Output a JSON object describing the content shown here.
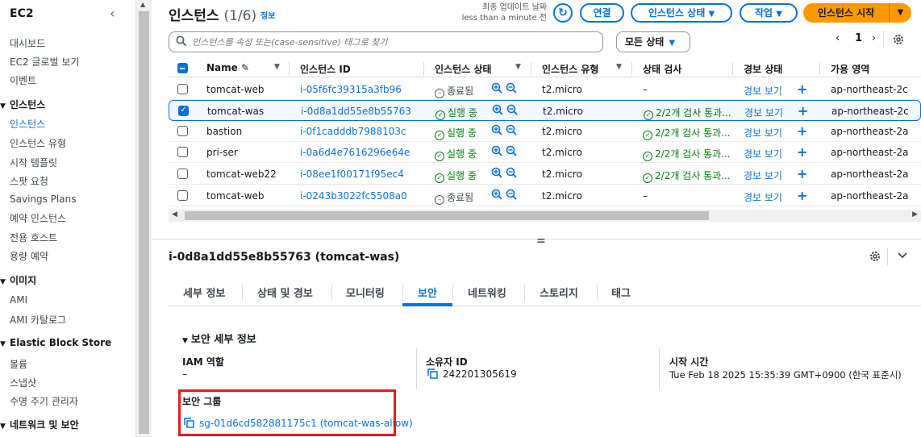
{
  "sidebar": {
    "title": "EC2",
    "items": [
      {
        "label": "대시보드",
        "type": "item"
      },
      {
        "label": "EC2 글로벌 보기",
        "type": "item"
      },
      {
        "label": "이벤트",
        "type": "item"
      },
      {
        "label": "인스턴스",
        "type": "section"
      },
      {
        "label": "인스턴스",
        "type": "item",
        "active": true
      },
      {
        "label": "인스턴스 유형",
        "type": "item"
      },
      {
        "label": "시작 템플릿",
        "type": "item"
      },
      {
        "label": "스팟 요청",
        "type": "item"
      },
      {
        "label": "Savings Plans",
        "type": "item"
      },
      {
        "label": "예약 인스턴스",
        "type": "item"
      },
      {
        "label": "전용 호스트",
        "type": "item"
      },
      {
        "label": "용량 예약",
        "type": "item"
      },
      {
        "label": "이미지",
        "type": "section"
      },
      {
        "label": "AMI",
        "type": "item"
      },
      {
        "label": "AMI 카탈로그",
        "type": "item"
      },
      {
        "label": "Elastic Block Store",
        "type": "section"
      },
      {
        "label": "볼륨",
        "type": "item"
      },
      {
        "label": "스냅샷",
        "type": "item"
      },
      {
        "label": "수명 주기 관리자",
        "type": "item"
      },
      {
        "label": "네트워크 및 보안",
        "type": "section"
      }
    ]
  },
  "header": {
    "title": "인스턴스",
    "count": "(1/6)",
    "info": "정보",
    "updated_line1": "최종 업데이트 날짜",
    "updated_line2": "less than a minute 전",
    "connect": "연결",
    "instance_state": "인스턴스 상태",
    "actions": "작업",
    "launch": "인스턴스 시작"
  },
  "search": {
    "placeholder": "인스턴스를 속성 또는(case-sensitive) 태그로 찾기",
    "filter": "모든 상태"
  },
  "pager": {
    "page": "1"
  },
  "table": {
    "headers": [
      "Name",
      "인스턴스 ID",
      "인스턴스 상태",
      "인스턴스 유형",
      "상태 검사",
      "경보 상태",
      "가용 영역"
    ],
    "rows": [
      {
        "name": "tomcat-web",
        "id": "i-05f6fc39315a3fb96",
        "state": "종료됨",
        "running": false,
        "type": "t2.micro",
        "check": "–",
        "alarm": "경보 보기",
        "az": "ap-northeast-2c",
        "selected": false
      },
      {
        "name": "tomcat-was",
        "id": "i-0d8a1dd55e8b55763",
        "state": "실행 중",
        "running": true,
        "type": "t2.micro",
        "check": "2/2개 검사 통과...",
        "alarm": "경보 보기",
        "az": "ap-northeast-2c",
        "selected": true
      },
      {
        "name": "bastion",
        "id": "i-0f1cadddb7988103c",
        "state": "실행 중",
        "running": true,
        "type": "t2.micro",
        "check": "2/2개 검사 통과...",
        "alarm": "경보 보기",
        "az": "ap-northeast-2a",
        "selected": false
      },
      {
        "name": "pri-ser",
        "id": "i-0a6d4e7616296e64e",
        "state": "실행 중",
        "running": true,
        "type": "t2.micro",
        "check": "2/2개 검사 통과...",
        "alarm": "경보 보기",
        "az": "ap-northeast-2a",
        "selected": false
      },
      {
        "name": "tomcat-web22",
        "id": "i-08ee1f00171f95ec4",
        "state": "실행 중",
        "running": true,
        "type": "t2.micro",
        "check": "2/2개 검사 통과...",
        "alarm": "경보 보기",
        "az": "ap-northeast-2a",
        "selected": false
      },
      {
        "name": "tomcat-web",
        "id": "i-0243b3022fc5508a0",
        "state": "종료됨",
        "running": false,
        "type": "t2.micro",
        "check": "–",
        "alarm": "경보 보기",
        "az": "ap-northeast-2a",
        "selected": false
      }
    ]
  },
  "detail": {
    "title": "i-0d8a1dd55e8b55763 (tomcat-was)",
    "tabs": [
      "세부 정보",
      "상태 및 경보",
      "모니터링",
      "보안",
      "네트워킹",
      "스토리지",
      "태그"
    ],
    "active_tab": "보안",
    "section": "보안 세부 정보",
    "iam_label": "IAM 역할",
    "iam_value": "–",
    "owner_label": "소유자 ID",
    "owner_value": "242201305619",
    "launch_label": "시작 시간",
    "launch_value": "Tue Feb 18 2025 15:35:39 GMT+0900 (한국 표준시)",
    "sg_label": "보안 그룹",
    "sg_value": "sg-01d6cd582881175c1 (tomcat-was-allow)"
  },
  "colors": {
    "accent": "#0972d3",
    "primary": "#ff9900",
    "running": "#037f0c",
    "highlight": "#e0201b"
  }
}
